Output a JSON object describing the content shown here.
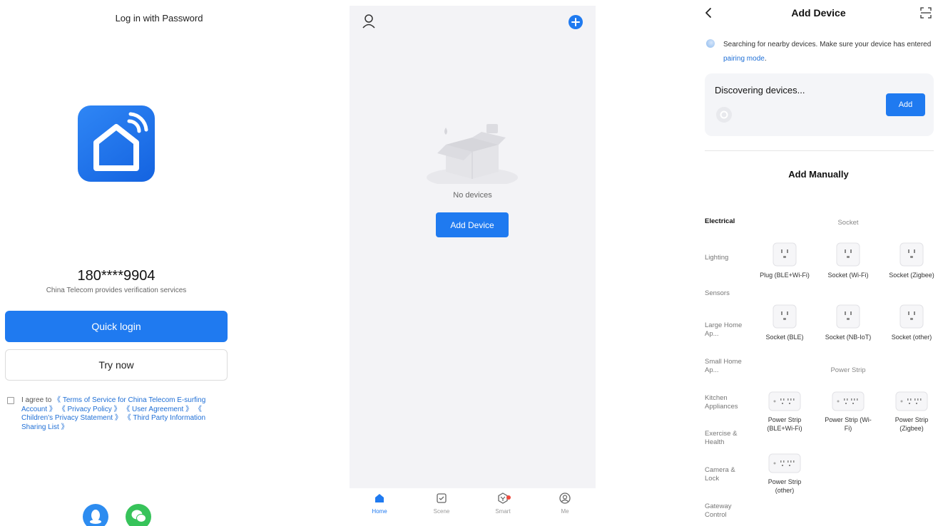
{
  "login": {
    "title": "Log in with Password",
    "phone": "180****9904",
    "verification": "China Telecom provides verification services",
    "quick_login": "Quick login",
    "try_now": "Try now",
    "agree_prefix": "I agree to",
    "links": [
      "《 Terms of Service for China Telecom E-surfing Account 》",
      "《 Privacy Policy 》",
      "《 User Agreement 》",
      "《 Children's Privacy Statement 》",
      "《 Third Party Information Sharing List 》"
    ],
    "social": [
      "qq-icon",
      "wechat-icon"
    ]
  },
  "home": {
    "empty_text": "No devices",
    "add_device": "Add Device",
    "tabs": [
      "Home",
      "Scene",
      "Smart",
      "Me"
    ]
  },
  "add_device": {
    "title": "Add Device",
    "searching_text": "Searching for nearby devices. Make sure your device has entered",
    "pairing_link": "pairing mode",
    "searching_end": ".",
    "discovering": "Discovering devices...",
    "add": "Add",
    "manual_title": "Add Manually",
    "categories": [
      "Electrical",
      "Lighting",
      "Sensors",
      "Large Home Ap...",
      "Small Home Ap...",
      "Kitchen Appliances",
      "Exercise & Health",
      "Camera & Lock",
      "Gateway Control"
    ],
    "section_socket": "Socket",
    "section_strip": "Power Strip",
    "sockets": [
      "Plug (BLE+Wi-Fi)",
      "Socket (Wi-Fi)",
      "Socket (Zigbee)",
      "Socket (BLE)",
      "Socket (NB-IoT)",
      "Socket (other)"
    ],
    "strips": [
      "Power Strip (BLE+Wi-Fi)",
      "Power Strip (Wi-Fi)",
      "Power Strip (Zigbee)",
      "Power Strip (other)"
    ]
  },
  "colors": {
    "accent": "#1f7af0",
    "badge": "#f04a3e",
    "link": "#1f6fd6"
  }
}
